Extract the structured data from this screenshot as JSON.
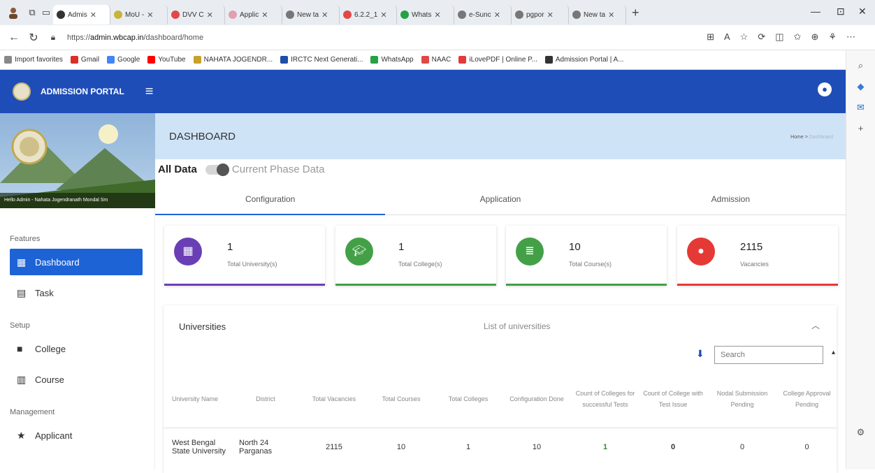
{
  "browser": {
    "tabs": [
      {
        "label": "Admis",
        "color": "#333333",
        "active": true
      },
      {
        "label": "MoU -",
        "color": "#c8b33a",
        "active": false
      },
      {
        "label": "DVV C",
        "color": "#e0484a",
        "active": false
      },
      {
        "label": "Applic",
        "color": "#e0a0b0",
        "active": false
      },
      {
        "label": "New ta",
        "color": "#777777",
        "active": false
      },
      {
        "label": "6.2.2_1",
        "color": "#e04848",
        "active": false
      },
      {
        "label": "Whats",
        "color": "#25a244",
        "active": false
      },
      {
        "label": "e-Sunc",
        "color": "#777777",
        "active": false
      },
      {
        "label": "pgpor",
        "color": "#777777",
        "active": false
      },
      {
        "label": "New ta",
        "color": "#777777",
        "active": false
      }
    ],
    "url_prefix": "https://",
    "url_host": "admin.wbcap.in",
    "url_path": "/dashboard/home",
    "favorites": [
      {
        "label": "Import favorites",
        "color": "#888888"
      },
      {
        "label": "Gmail",
        "color": "#d93025"
      },
      {
        "label": "Google",
        "color": "#4285f4"
      },
      {
        "label": "YouTube",
        "color": "#ff0000"
      },
      {
        "label": "NAHATA JOGENDR...",
        "color": "#c8a02a"
      },
      {
        "label": "IRCTC Next Generati...",
        "color": "#1f4fa8"
      },
      {
        "label": "WhatsApp",
        "color": "#25a244"
      },
      {
        "label": "NAAC",
        "color": "#e04848"
      },
      {
        "label": "iLovePDF | Online P...",
        "color": "#e23b3b"
      },
      {
        "label": "Admission Portal | A...",
        "color": "#333333"
      }
    ]
  },
  "header": {
    "portal_name": "ADMISSION PORTAL",
    "menu_icon": "hamburger-icon",
    "user_icon": "account-circle-icon"
  },
  "sidebar": {
    "hello_text": "Hello Admin - Nahata Jogendranath Mondal Sm",
    "sections": [
      {
        "title": "Features",
        "items": [
          {
            "label": "Dashboard",
            "icon": "dashboard-icon",
            "active": true
          },
          {
            "label": "Task",
            "icon": "task-icon",
            "active": false
          }
        ]
      },
      {
        "title": "Setup",
        "items": [
          {
            "label": "College",
            "icon": "college-icon",
            "active": false
          },
          {
            "label": "Course",
            "icon": "course-icon",
            "active": false
          }
        ]
      },
      {
        "title": "Management",
        "items": [
          {
            "label": "Applicant",
            "icon": "star-icon",
            "active": false
          }
        ]
      }
    ]
  },
  "page": {
    "title": "DASHBOARD",
    "breadcrumb_home": "Home",
    "breadcrumb_sep": ">",
    "breadcrumb_current": "Dashboard",
    "toggle_left": "All Data",
    "toggle_right": "Current Phase Data",
    "tabs": [
      "Configuration",
      "Application",
      "Admission"
    ]
  },
  "stats": [
    {
      "value": "1",
      "label": "Total University(s)",
      "color": "#6a3fb5",
      "icon": "building-icon"
    },
    {
      "value": "1",
      "label": "Total College(s)",
      "color": "#43a047",
      "icon": "graduation-cap-icon"
    },
    {
      "value": "10",
      "label": "Total Course(s)",
      "color": "#43a047",
      "icon": "list-icon"
    },
    {
      "value": "2115",
      "label": "Vacancies",
      "color": "#e53935",
      "icon": "person-icon"
    }
  ],
  "universities": {
    "title": "Universities",
    "subtitle": "List of universities",
    "search_placeholder": "Search",
    "columns": [
      "University Name",
      "District",
      "Total Vacancies",
      "Total Courses",
      "Total Colleges",
      "Configuration Done",
      "Count of Colleges for successful Tests",
      "Count of College with Test Issue",
      "Nodal Submission Pending",
      "College Approval Pending"
    ],
    "rows": [
      [
        "West Bengal State University",
        "North 24 Parganas",
        "2115",
        "10",
        "1",
        "10",
        "1",
        "0",
        "0",
        "0"
      ]
    ]
  }
}
